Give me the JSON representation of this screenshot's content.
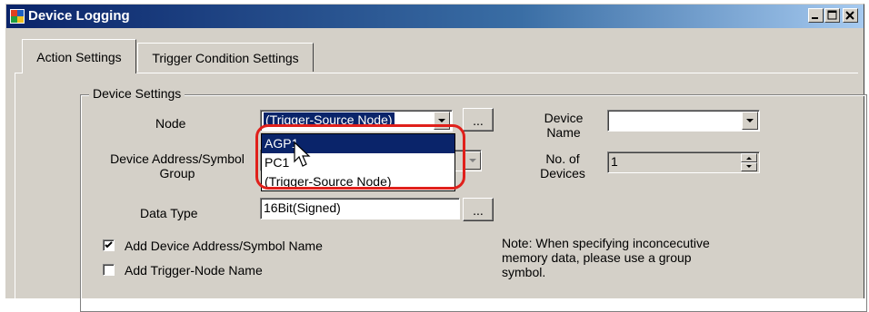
{
  "window": {
    "title": "Device Logging"
  },
  "tabs": [
    {
      "label": "Action Settings",
      "active": true
    },
    {
      "label": "Trigger Condition Settings",
      "active": false
    }
  ],
  "device_settings": {
    "group_title": "Device Settings",
    "node_label": "Node",
    "node_value": "(Trigger-Source Node)",
    "node_options": [
      "AGP1",
      "PC1",
      "(Trigger-Source Node)"
    ],
    "node_highlighted": "AGP1",
    "ellipsis_label": "...",
    "device_name_label_1": "Device",
    "device_name_label_2": "Name",
    "device_name_value": "",
    "address_label_1": "Device Address/Symbol",
    "address_label_2": "Group",
    "no_devices_label_1": "No. of",
    "no_devices_label_2": "Devices",
    "no_devices_value": "1",
    "data_type_label": "Data Type",
    "data_type_value": "16Bit(Signed)",
    "add_address_label": "Add Device Address/Symbol Name",
    "add_address_checked": true,
    "add_trigger_label": "Add Trigger-Node Name",
    "add_trigger_checked": false,
    "note_1": "Note: When specifying inconcecutive",
    "note_2": "memory data, please use a group",
    "note_3": "symbol."
  },
  "colors": {
    "highlight_ring": "#e0201b",
    "selection": "#0a246a",
    "face": "#d4d0c8"
  }
}
